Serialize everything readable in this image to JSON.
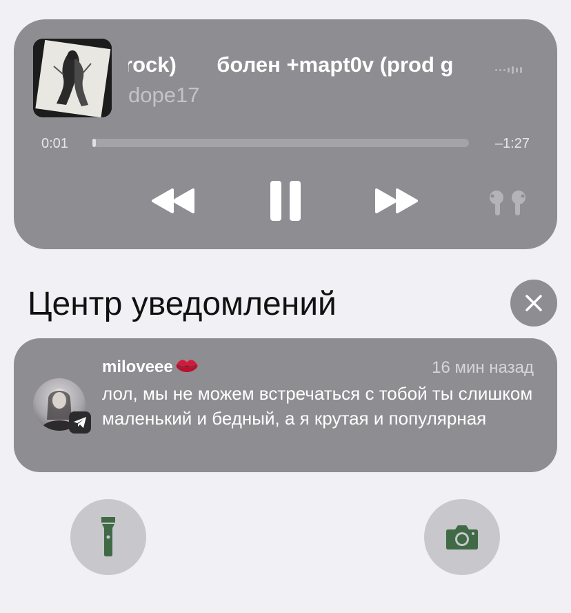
{
  "player": {
    "title_segments": [
      "rock)",
      "болен +mapt0v (prod g"
    ],
    "artist": "dope17",
    "elapsed": "0:01",
    "remaining": "–1:27",
    "progress_fraction": 0.01,
    "icons": {
      "previous": "backward-icon",
      "pause": "pause-icon",
      "next": "forward-icon",
      "output": "airpods-icon",
      "waveform": "waveform-icon"
    }
  },
  "notification_center": {
    "title": "Центр уведомлений",
    "close_icon": "close-icon"
  },
  "notification": {
    "sender": "miloveee",
    "sender_emoji": "kiss-mark-icon",
    "time": "16 мин назад",
    "message": "лол, мы не можем встречаться с тобой ты слишком маленький и бедный, а я крутая и популярная",
    "app_icon": "telegram-icon"
  },
  "quick_actions": {
    "flashlight_icon": "flashlight-icon",
    "camera_icon": "camera-icon"
  },
  "colors": {
    "background": "#f1f0f5",
    "card": "#8e8d92",
    "quick_button": "#c8c7cc",
    "quick_glyph": "#3f6a45"
  }
}
